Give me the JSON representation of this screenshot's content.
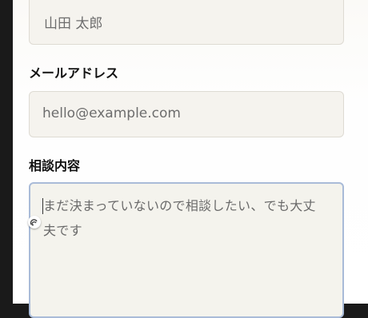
{
  "form": {
    "name_field": {
      "value": "山田 太郎"
    },
    "email_label": "メールアドレス",
    "email_field": {
      "placeholder": "hello@example.com"
    },
    "consult_label": "相談内容",
    "consult_field": {
      "value": "まだ決まっていないので相談したい、でも大丈夫です"
    }
  },
  "colors": {
    "field_background": "#f5f3ee",
    "focus_border": "#a9bbd8",
    "label_text": "#111111",
    "field_text": "#6d6d6d"
  },
  "icons": {
    "text_assist": "ring-arcs-icon"
  }
}
